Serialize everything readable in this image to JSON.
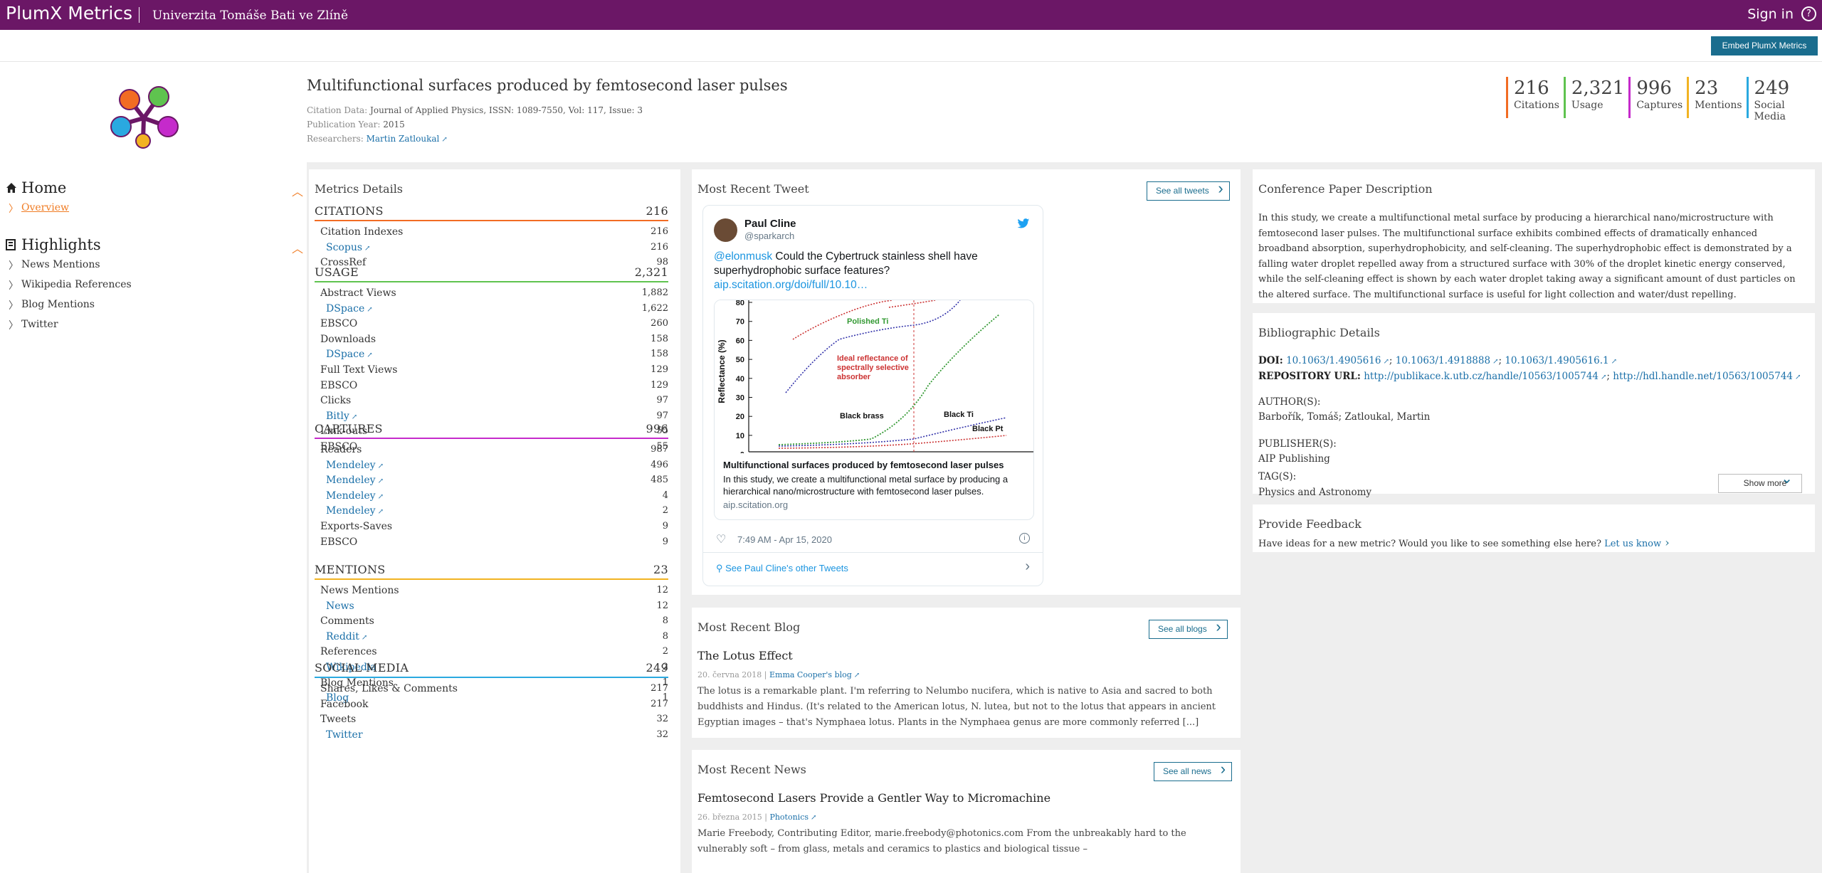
{
  "header": {
    "brand": "PlumX Metrics",
    "institution": "Univerzita Tomáše Bati ve Zlíně",
    "sign_in": "Sign in",
    "help": "?",
    "embed_button": "Embed PlumX Metrics"
  },
  "nav": {
    "home": "Home",
    "overview": "Overview",
    "highlights": "Highlights",
    "items": [
      "News Mentions",
      "Wikipedia References",
      "Blog Mentions",
      "Twitter"
    ]
  },
  "article": {
    "title": "Multifunctional surfaces produced by femtosecond laser pulses",
    "citation_label": "Citation Data:",
    "citation_value": "Journal of Applied Physics, ISSN: 1089-7550, Vol: 117, Issue: 3",
    "year_label": "Publication Year:",
    "year_value": "2015",
    "researchers_label": "Researchers:",
    "researchers_value": "Martin Zatloukal"
  },
  "stats": [
    {
      "num": "216",
      "label": "Citations",
      "color": "#f26c23"
    },
    {
      "num": "2,321",
      "label": "Usage",
      "color": "#5fc34f"
    },
    {
      "num": "996",
      "label": "Captures",
      "color": "#c52acb"
    },
    {
      "num": "23",
      "label": "Mentions",
      "color": "#f2b322"
    },
    {
      "num": "249",
      "label": "Social Media",
      "color": "#2aa9e0"
    }
  ],
  "metrics": {
    "title": "Metrics Details",
    "sections": [
      {
        "name": "CITATIONS",
        "value": "216",
        "color": "#f26c23",
        "rows": [
          {
            "l": "Citation Indexes",
            "v": "216",
            "lvl": 1
          },
          {
            "l": "Scopus",
            "v": "216",
            "lvl": 2,
            "ext": true
          },
          {
            "l": "CrossRef",
            "v": "98",
            "lvl": 1
          }
        ]
      },
      {
        "name": "USAGE",
        "value": "2,321",
        "color": "#5fc34f",
        "rows": [
          {
            "l": "Abstract Views",
            "v": "1,882",
            "lvl": 1
          },
          {
            "l": "DSpace",
            "v": "1,622",
            "lvl": 2,
            "ext": true
          },
          {
            "l": "EBSCO",
            "v": "260",
            "lvl": 1
          },
          {
            "l": "Downloads",
            "v": "158",
            "lvl": 1
          },
          {
            "l": "DSpace",
            "v": "158",
            "lvl": 2,
            "ext": true
          },
          {
            "l": "Full Text Views",
            "v": "129",
            "lvl": 1
          },
          {
            "l": "EBSCO",
            "v": "129",
            "lvl": 1
          },
          {
            "l": "Clicks",
            "v": "97",
            "lvl": 1
          },
          {
            "l": "Bitly",
            "v": "97",
            "lvl": 2,
            "ext": true
          },
          {
            "l": "Link-outs",
            "v": "55",
            "lvl": 1
          },
          {
            "l": "EBSCO",
            "v": "55",
            "lvl": 1
          }
        ]
      },
      {
        "name": "CAPTURES",
        "value": "996",
        "color": "#c52acb",
        "rows": [
          {
            "l": "Readers",
            "v": "987",
            "lvl": 1
          },
          {
            "l": "Mendeley",
            "v": "496",
            "lvl": 2,
            "ext": true
          },
          {
            "l": "Mendeley",
            "v": "485",
            "lvl": 2,
            "ext": true
          },
          {
            "l": "Mendeley",
            "v": "4",
            "lvl": 2,
            "ext": true
          },
          {
            "l": "Mendeley",
            "v": "2",
            "lvl": 2,
            "ext": true
          },
          {
            "l": "Exports-Saves",
            "v": "9",
            "lvl": 1
          },
          {
            "l": "EBSCO",
            "v": "9",
            "lvl": 1
          }
        ]
      },
      {
        "name": "MENTIONS",
        "value": "23",
        "color": "#f2b322",
        "rows": [
          {
            "l": "News Mentions",
            "v": "12",
            "lvl": 1
          },
          {
            "l": "News",
            "v": "12",
            "lvl": 2
          },
          {
            "l": "Comments",
            "v": "8",
            "lvl": 1
          },
          {
            "l": "Reddit",
            "v": "8",
            "lvl": 2,
            "ext": true
          },
          {
            "l": "References",
            "v": "2",
            "lvl": 1
          },
          {
            "l": "Wikipedia",
            "v": "2",
            "lvl": 2
          },
          {
            "l": "Blog Mentions",
            "v": "1",
            "lvl": 1
          },
          {
            "l": "Blog",
            "v": "1",
            "lvl": 2
          }
        ]
      },
      {
        "name": "SOCIAL MEDIA",
        "value": "249",
        "color": "#2aa9e0",
        "rows": [
          {
            "l": "Shares, Likes & Comments",
            "v": "217",
            "lvl": 1
          },
          {
            "l": "Facebook",
            "v": "217",
            "lvl": 1
          },
          {
            "l": "Tweets",
            "v": "32",
            "lvl": 1
          },
          {
            "l": "Twitter",
            "v": "32",
            "lvl": 2
          }
        ]
      }
    ]
  },
  "tweet": {
    "section_title": "Most Recent Tweet",
    "see_all": "See all tweets",
    "name": "Paul Cline",
    "handle": "@sparkarch",
    "mention": "@elonmusk",
    "text": " Could the Cybertruck stainless shell have superhydrophobic surface features?",
    "link": "aip.scitation.org/doi/full/10.10…",
    "card_title": "Multifunctional surfaces produced by femtosecond laser pulses",
    "card_desc": "In this study, we create a multifunctional metal surface by producing a hierarchical nano/microstructure with femtosecond laser pulses.",
    "card_site": "aip.scitation.org",
    "time": "7:49 AM - Apr 15, 2020",
    "more": "See Paul Cline's other Tweets",
    "plot": {
      "ylabel": "Reflectance (%)",
      "yticks": [
        "80",
        "70",
        "60",
        "50",
        "40",
        "30",
        "20",
        "10",
        "0"
      ],
      "labels": {
        "polished": "Polished Ti",
        "ideal": "Ideal reflectance of spectrally selective absorber",
        "brass": "Black brass",
        "ti": "Black Ti",
        "pt": "Black Pt"
      }
    }
  },
  "blog": {
    "section_title": "Most Recent Blog",
    "see_all": "See all blogs",
    "title": "The Lotus Effect",
    "date": "20. června 2018",
    "source": "Emma Cooper's blog",
    "body": "The lotus is a remarkable plant. I'm referring to Nelumbo nucifera, which is native to Asia and sacred to both buddhists and Hindus. (It's related to the American lotus, N. lutea, but not to the lotus that appears in ancient Egyptian images – that's Nymphaea lotus. Plants in the Nymphaea genus are more commonly referred [...]"
  },
  "news": {
    "section_title": "Most Recent News",
    "see_all": "See all news",
    "title": "Femtosecond Lasers Provide a Gentler Way to Micromachine",
    "date": "26. března 2015",
    "source": "Photonics",
    "body": "Marie Freebody, Contributing Editor, marie.freebody@photonics.com From the unbreakably hard to the vulnerably soft – from glass, metals and ceramics to plastics and biological tissue –"
  },
  "description": {
    "title": "Conference Paper Description",
    "body": "In this study, we create a multifunctional metal surface by producing a hierarchical nano/microstructure with femtosecond laser pulses. The multifunctional surface exhibits combined effects of dramatically enhanced broadband absorption, superhydrophobicity, and self-cleaning. The superhydrophobic effect is demonstrated by a falling water droplet repelled away from a structured surface with 30% of the droplet kinetic energy conserved, while the self-cleaning effect is shown by each water droplet taking away a significant amount of dust particles on the altered surface. The multifunctional surface is useful for light collection and water/dust repelling."
  },
  "bibliographic": {
    "title": "Bibliographic Details",
    "doi_label": "DOI:",
    "doi_links": [
      "10.1063/1.4905616",
      "10.1063/1.4918888",
      "10.1063/1.4905616.1"
    ],
    "repo_label": "REPOSITORY URL:",
    "repo_links": [
      "http://publikace.k.utb.cz/handle/10563/1005744",
      "http://hdl.handle.net/10563/1005744"
    ],
    "authors_label": "AUTHOR(S):",
    "authors": "Barbořík, Tomáš; Zatloukal, Martin",
    "publishers_label": "PUBLISHER(S):",
    "publishers": "AIP Publishing",
    "tags_label": "TAG(S):",
    "tags": "Physics and Astronomy",
    "show_more": "Show more"
  },
  "feedback": {
    "title": "Provide Feedback",
    "text": "Have ideas for a new metric? Would you like to see something else here?",
    "link": "Let us know"
  }
}
